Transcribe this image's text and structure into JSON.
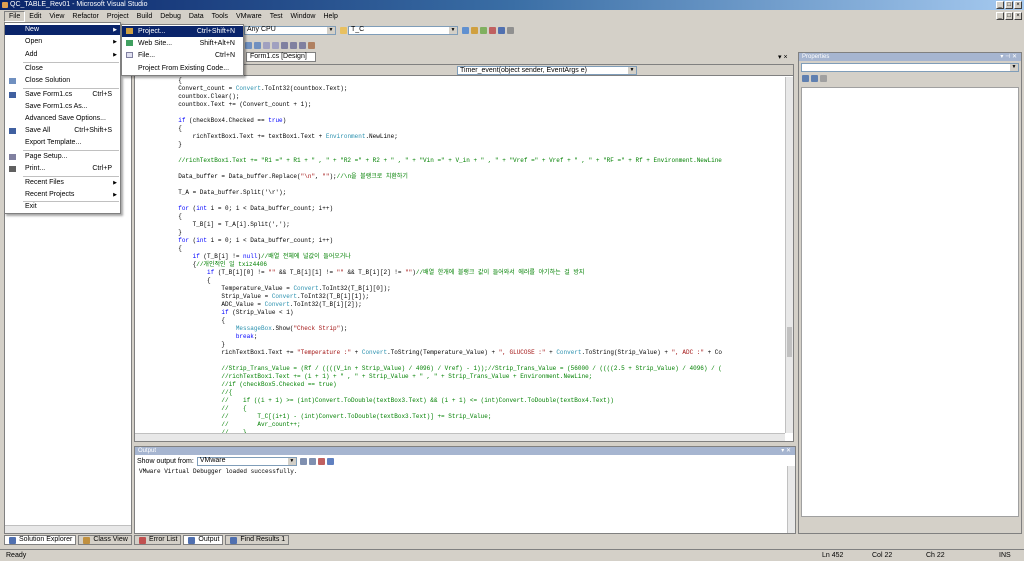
{
  "window": {
    "title": "QC_TABLE_Rev01 - Microsoft Visual Studio"
  },
  "menubar": [
    "File",
    "Edit",
    "View",
    "Refactor",
    "Project",
    "Build",
    "Debug",
    "Data",
    "Tools",
    "VMware",
    "Test",
    "Window",
    "Help"
  ],
  "toolbar": {
    "platform": "Any CPU",
    "project_combo": "T_C"
  },
  "file_menu": {
    "items": [
      {
        "label": "New",
        "shortcut": "",
        "submenu": true
      },
      {
        "label": "Open",
        "shortcut": "",
        "submenu": true
      },
      {
        "label": "Add",
        "shortcut": "",
        "submenu": true
      },
      {
        "label": "Close",
        "shortcut": "",
        "submenu": false
      },
      {
        "label": "Close Solution",
        "shortcut": "",
        "submenu": false
      },
      {
        "label": "Save Form1.cs",
        "shortcut": "Ctrl+S",
        "submenu": false
      },
      {
        "label": "Save Form1.cs As...",
        "shortcut": "",
        "submenu": false
      },
      {
        "label": "Advanced Save Options...",
        "shortcut": "",
        "submenu": false
      },
      {
        "label": "Save All",
        "shortcut": "Ctrl+Shift+S",
        "submenu": false
      },
      {
        "label": "Export Template...",
        "shortcut": "",
        "submenu": false
      },
      {
        "label": "Page Setup...",
        "shortcut": "",
        "submenu": false
      },
      {
        "label": "Print...",
        "shortcut": "Ctrl+P",
        "submenu": false
      },
      {
        "label": "Recent Files",
        "shortcut": "",
        "submenu": true
      },
      {
        "label": "Recent Projects",
        "shortcut": "",
        "submenu": true
      },
      {
        "label": "Exit",
        "shortcut": "",
        "submenu": false
      }
    ]
  },
  "new_submenu": {
    "items": [
      {
        "label": "Project...",
        "shortcut": "Ctrl+Shift+N"
      },
      {
        "label": "Web Site...",
        "shortcut": "Shift+Alt+N"
      },
      {
        "label": "File...",
        "shortcut": "Ctrl+N"
      },
      {
        "label": "Project From Existing Code...",
        "shortcut": ""
      }
    ]
  },
  "editor": {
    "tab": "Form1.cs [Design]",
    "method_combo": "Timer_event(object sender, EventArgs e)"
  },
  "code_lines": [
    "            {",
    "            Convert_count = Convert.ToInt32(countbox.Text);",
    "            countbox.Clear();",
    "            countbox.Text += (Convert_count + 1);",
    "",
    "            if (checkBox4.Checked == true)",
    "            {",
    "                richTextBox1.Text += textBox1.Text + Environment.NewLine;",
    "            }",
    "",
    "            //richTextBox1.Text += \"R1 =\" + R1 + \" , \" + \"R2 =\" + R2 + \" , \" + \"Vin =\" + V_in + \" , \" + \"Vref =\" + Vref + \" , \" + \"RF =\" + Rf + Environment.NewLine",
    "",
    "            Data_buffer = Data_buffer.Replace(\"\\n\", \"\");//\\n을 블랭크로 치환하기",
    "",
    "            T_A = Data_buffer.Split('\\r');",
    "",
    "            for (int i = 0; i < Data_buffer_count; i++)",
    "            {",
    "                T_B[i] = T_A[i].Split(',');",
    "            }",
    "            for (int i = 0; i < Data_buffer_count; i++)",
    "            {",
    "                if (T_B[i] != null)//배열 전체에 널값이 들어오거나",
    "                {//개인적인 일 txiz4406",
    "                    if (T_B[i][0] != \"\" && T_B[i][1] != \"\" && T_B[i][2] != \"\")//배열 한개에 블랭크 값이 들어와서 에러를 야기하는 걸 방지",
    "                    {",
    "                        Temperature_Value = Convert.ToInt32(T_B[i][0]);",
    "                        Strip_Value = Convert.ToInt32(T_B[i][1]);",
    "                        ADC_Value = Convert.ToInt32(T_B[i][2]);",
    "                        if (Strip_Value < 1)",
    "                        {",
    "                            MessageBox.Show(\"Check Strip\");",
    "                            break;",
    "                        }",
    "                        richTextBox1.Text += \"Temperature :\" + Convert.ToString(Temperature_Value) + \", GLUCOSE :\" + Convert.ToString(Strip_Value) + \", ADC :\" + Co",
    "",
    "                        //Strip_Trans_Value = (Rf / ((((V_in + Strip_Value) / 4096) / Vref) - 1));//Strip_Trans_Value = (56000 / ((((2.5 + Strip_Value) / 4096) / (",
    "                        //richTextBox1.Text += (i + 1) + \" , \" + Strip_Value + \" , \" + Strip_Trans_Value + Environment.NewLine;",
    "                        //if (checkBox5.Checked == true)",
    "                        //{",
    "                        //    if ((i + 1) >= (int)Convert.ToDouble(textBox3.Text) && (i + 1) <= (int)Convert.ToDouble(textBox4.Text))",
    "                        //    {",
    "                        //        T_C[(i+1) - (int)Convert.ToDouble(textBox3.Text)] += Strip_Value;",
    "                        //        Avr_count++;",
    "                        //    }",
    "                        //}",
    "                    }",
    "                }"
  ],
  "output": {
    "title": "Output",
    "show_label": "Show output from:",
    "source": "VMware",
    "text": "VMware Virtual Debugger loaded successfully."
  },
  "properties": {
    "title": "Properties"
  },
  "bottom_tabs_left": [
    "Solution Explorer",
    "Class View"
  ],
  "bottom_tabs_right": [
    "Error List",
    "Output",
    "Find Results 1"
  ],
  "status": {
    "ready": "Ready",
    "ln": "Ln 452",
    "col": "Col 22",
    "ch": "Ch 22",
    "ins": "INS"
  }
}
